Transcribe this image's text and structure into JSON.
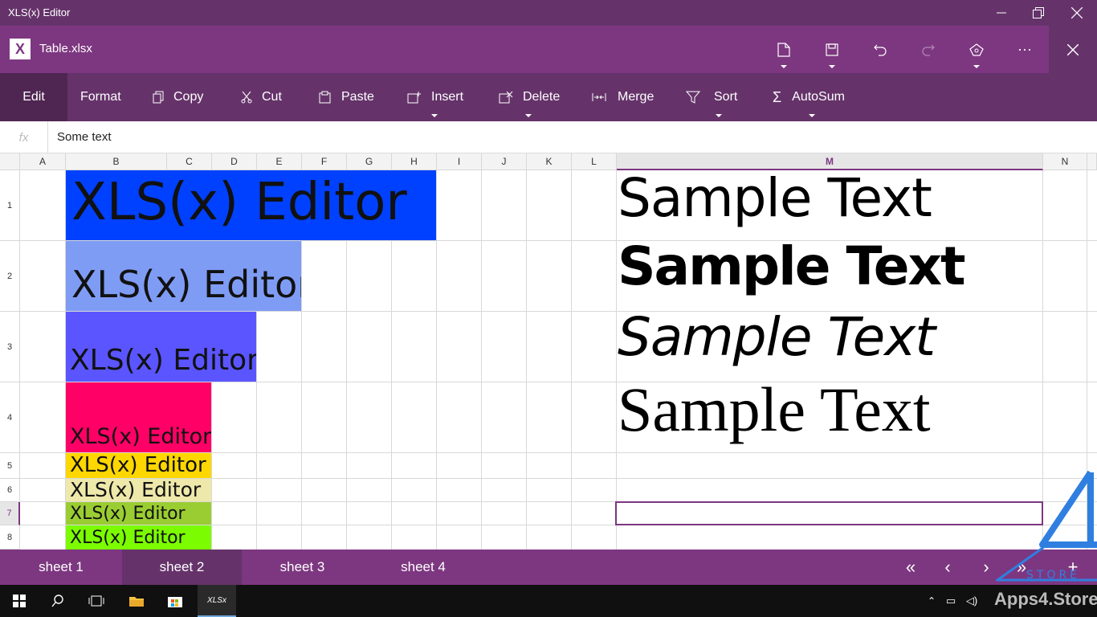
{
  "window": {
    "title": "XLS(x) Editor"
  },
  "appbar": {
    "logo": "X",
    "filename": "Table.xlsx"
  },
  "ribbon": {
    "edit": "Edit",
    "format": "Format",
    "copy": "Copy",
    "cut": "Cut",
    "paste": "Paste",
    "insert": "Insert",
    "delete": "Delete",
    "merge": "Merge",
    "sort": "Sort",
    "autosum": "AutoSum"
  },
  "formula_bar": {
    "fx": "fx",
    "value": "Some text"
  },
  "columns": [
    "A",
    "B",
    "C",
    "D",
    "E",
    "F",
    "G",
    "H",
    "I",
    "J",
    "K",
    "L",
    "M",
    "N"
  ],
  "rows": [
    "1",
    "2",
    "3",
    "4",
    "5",
    "6",
    "7",
    "8"
  ],
  "cells": {
    "b1": {
      "text": "XLS(x) Editor",
      "bg": "#0041ff"
    },
    "b2": {
      "text": "XLS(x) Editor",
      "bg": "#7f9cf5"
    },
    "b3": {
      "text": "XLS(x) Editor",
      "bg": "#5a55ff"
    },
    "b4": {
      "text": "XLS(x) Editor",
      "bg": "#ff0066"
    },
    "b5": {
      "text": "XLS(x) Editor",
      "bg": "#ffd700"
    },
    "b6": {
      "text": "XLS(x) Editor",
      "bg": "#eee8aa"
    },
    "b7": {
      "text": "XLS(x) Editor",
      "bg": "#9acd32"
    },
    "b8": {
      "text": "XLS(x) Editor",
      "bg": "#7cfc00"
    },
    "m1": "Sample Text",
    "m2": "Sample Text",
    "m3": "Sample Text",
    "m4": "Sample Text"
  },
  "sheets": [
    "sheet 1",
    "sheet 2",
    "sheet 3",
    "sheet 4"
  ],
  "active_sheet": "sheet 2",
  "taskbar": {
    "app_label": "XLSx"
  },
  "watermark": {
    "text": "Apps4.Store",
    "logo_text": "STORE"
  },
  "colors": {
    "accent": "#7d3780",
    "title_bar": "#65336a",
    "ribbon": "#65336a"
  }
}
